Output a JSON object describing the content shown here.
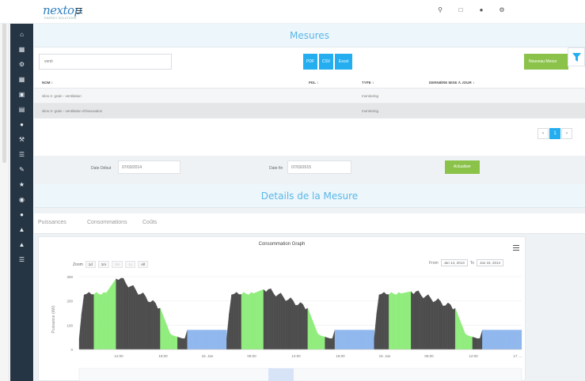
{
  "header": {
    "logo": "nextop",
    "logo_subtitle": "ENERGY SOLUTIONS",
    "icons": [
      "search-icon",
      "window-icon",
      "bell-icon",
      "gear-icon"
    ]
  },
  "sidebar": {
    "icons": [
      "home-icon",
      "dashboard-icon",
      "settings-icon",
      "grid-icon",
      "inbox-icon",
      "document-icon",
      "chat-icon",
      "tools-icon",
      "list-icon",
      "edit-icon",
      "star-icon",
      "globe-icon",
      "cloud-icon",
      "droplet-icon",
      "building-icon",
      "menu-icon"
    ]
  },
  "mesures": {
    "title": "Mesures",
    "search_value": "venti",
    "export_buttons": [
      "PDF",
      "CSV",
      "Excel"
    ],
    "new_button": "Nouveau Mesur",
    "columns": [
      "NOM",
      "PDL",
      "TYPE",
      "DERNIÈRE MISE À JOUR"
    ],
    "rows": [
      {
        "nom": "silos 2- grain - ventilation",
        "pdl": "",
        "type": "monitoring",
        "date": ""
      },
      {
        "nom": "silos 3- grain - ventilation d'évacuation",
        "pdl": "",
        "type": "monitoring",
        "date": ""
      }
    ],
    "pager": [
      "‹",
      "1",
      "›"
    ]
  },
  "dates": {
    "start_label": "Date Début",
    "start_value": "07/03/2014",
    "end_label": "Date fin",
    "end_value": "07/03/2015",
    "update_button": "Actualiser"
  },
  "details": {
    "title": "Details de la Mesure",
    "tabs": [
      "Puissances",
      "Consommations",
      "Coûts"
    ]
  },
  "chart": {
    "title": "Consommation Graph",
    "zoom_label": "Zoom",
    "zoom_buttons": [
      "1d",
      "1m",
      "3m",
      "1y",
      "All"
    ],
    "from_label": "From",
    "from_value": "Jan 14, 2013",
    "to_label": "To",
    "to_value": "Jan 16, 2013",
    "ylabel": "Puissance (kW)",
    "yticks": [
      "300",
      "200",
      "100",
      "0"
    ],
    "xticks": [
      "12:00",
      "18:00",
      "15. Jan",
      "06:00",
      "12:00",
      "18:00",
      "16. Jan",
      "06:00",
      "12:00",
      "17. ..."
    ],
    "colors": {
      "dark": "#4d4d4d",
      "green": "#90ed7d",
      "blue": "#90b8ee",
      "accent": "#24aef0",
      "success": "#8bc34a",
      "sidebar": "#263544"
    }
  },
  "chart_data": {
    "type": "area",
    "title": "Consommation Graph",
    "ylabel": "Puissance (kW)",
    "ylim": [
      0,
      300
    ],
    "x": [
      "Jan 14 06:00",
      "Jan 14 07:00",
      "Jan 14 09:00",
      "Jan 14 12:00",
      "Jan 14 15:00",
      "Jan 14 18:00",
      "Jan 14 21:00",
      "Jan 15 00:00",
      "Jan 15 03:00",
      "Jan 15 06:00",
      "Jan 15 07:00",
      "Jan 15 09:00",
      "Jan 15 12:00",
      "Jan 15 15:00",
      "Jan 15 18:00",
      "Jan 15 21:00",
      "Jan 16 00:00",
      "Jan 16 03:00",
      "Jan 16 06:00",
      "Jan 16 07:00",
      "Jan 16 09:00",
      "Jan 16 12:00",
      "Jan 16 15:00",
      "Jan 16 18:00",
      "Jan 16 21:00"
    ],
    "series": [
      {
        "name": "",
        "values": [
          230,
          240,
          300,
          250,
          180,
          60,
          45,
          80,
          80,
          230,
          250,
          320,
          260,
          180,
          60,
          45,
          80,
          80,
          240,
          260,
          320,
          270,
          180,
          70,
          50
        ]
      }
    ]
  }
}
